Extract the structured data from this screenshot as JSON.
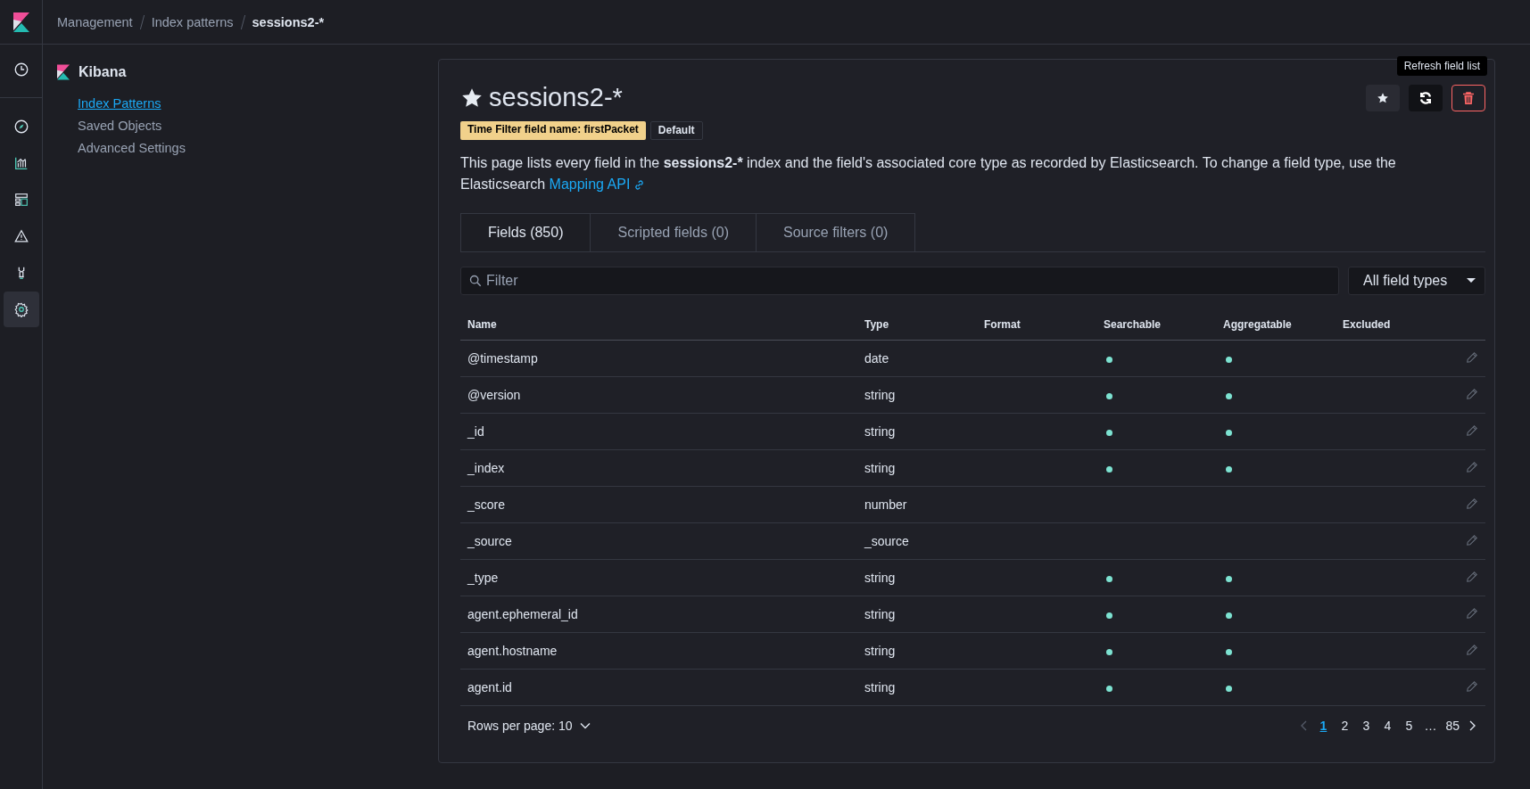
{
  "breadcrumbs": [
    {
      "label": "Management",
      "current": false
    },
    {
      "label": "Index patterns",
      "current": false
    },
    {
      "label": "sessions2-*",
      "current": true
    }
  ],
  "nav_rail": [
    {
      "selected": false
    },
    {
      "selected": false
    },
    {
      "selected": false
    },
    {
      "selected": false
    },
    {
      "selected": false
    },
    {
      "selected": false
    },
    {
      "selected": true
    }
  ],
  "sidebar": {
    "title": "Kibana",
    "items": [
      {
        "label": "Index Patterns",
        "selected": true
      },
      {
        "label": "Saved Objects",
        "selected": false
      },
      {
        "label": "Advanced Settings",
        "selected": false
      }
    ]
  },
  "page": {
    "title": "sessions2-*",
    "tooltip": "Refresh field list",
    "badges": [
      {
        "label": "Time Filter field name: firstPacket",
        "kind": "accent"
      },
      {
        "label": "Default",
        "kind": "plain"
      }
    ],
    "description": {
      "before": "This page lists every field in the ",
      "bold": "sessions2-*",
      "after": " index and the field's associated core type as recorded by Elasticsearch. To change a field type, use the Elasticsearch ",
      "link": "Mapping API"
    },
    "tabs": [
      {
        "label": "Fields (850)",
        "selected": true
      },
      {
        "label": "Scripted fields (0)",
        "selected": false
      },
      {
        "label": "Source filters (0)",
        "selected": false
      }
    ],
    "filter": {
      "placeholder": "Filter"
    },
    "type_select": {
      "value": "All field types"
    },
    "table": {
      "columns": [
        "Name",
        "Type",
        "Format",
        "Searchable",
        "Aggregatable",
        "Excluded"
      ],
      "rows": [
        {
          "name": "@timestamp",
          "type": "date",
          "searchable": true,
          "aggregatable": true
        },
        {
          "name": "@version",
          "type": "string",
          "searchable": true,
          "aggregatable": true
        },
        {
          "name": "_id",
          "type": "string",
          "searchable": true,
          "aggregatable": true
        },
        {
          "name": "_index",
          "type": "string",
          "searchable": true,
          "aggregatable": true
        },
        {
          "name": "_score",
          "type": "number",
          "searchable": false,
          "aggregatable": false
        },
        {
          "name": "_source",
          "type": "_source",
          "searchable": false,
          "aggregatable": false
        },
        {
          "name": "_type",
          "type": "string",
          "searchable": true,
          "aggregatable": true
        },
        {
          "name": "agent.ephemeral_id",
          "type": "string",
          "searchable": true,
          "aggregatable": true
        },
        {
          "name": "agent.hostname",
          "type": "string",
          "searchable": true,
          "aggregatable": true
        },
        {
          "name": "agent.id",
          "type": "string",
          "searchable": true,
          "aggregatable": true
        }
      ]
    },
    "rows_per_page": "Rows per page: 10",
    "pagination": [
      {
        "label": "1",
        "selected": true
      },
      {
        "label": "2",
        "selected": false
      },
      {
        "label": "3",
        "selected": false
      },
      {
        "label": "4",
        "selected": false
      },
      {
        "label": "5",
        "selected": false
      },
      {
        "label": "…",
        "selected": false
      },
      {
        "label": "85",
        "selected": false
      }
    ]
  }
}
